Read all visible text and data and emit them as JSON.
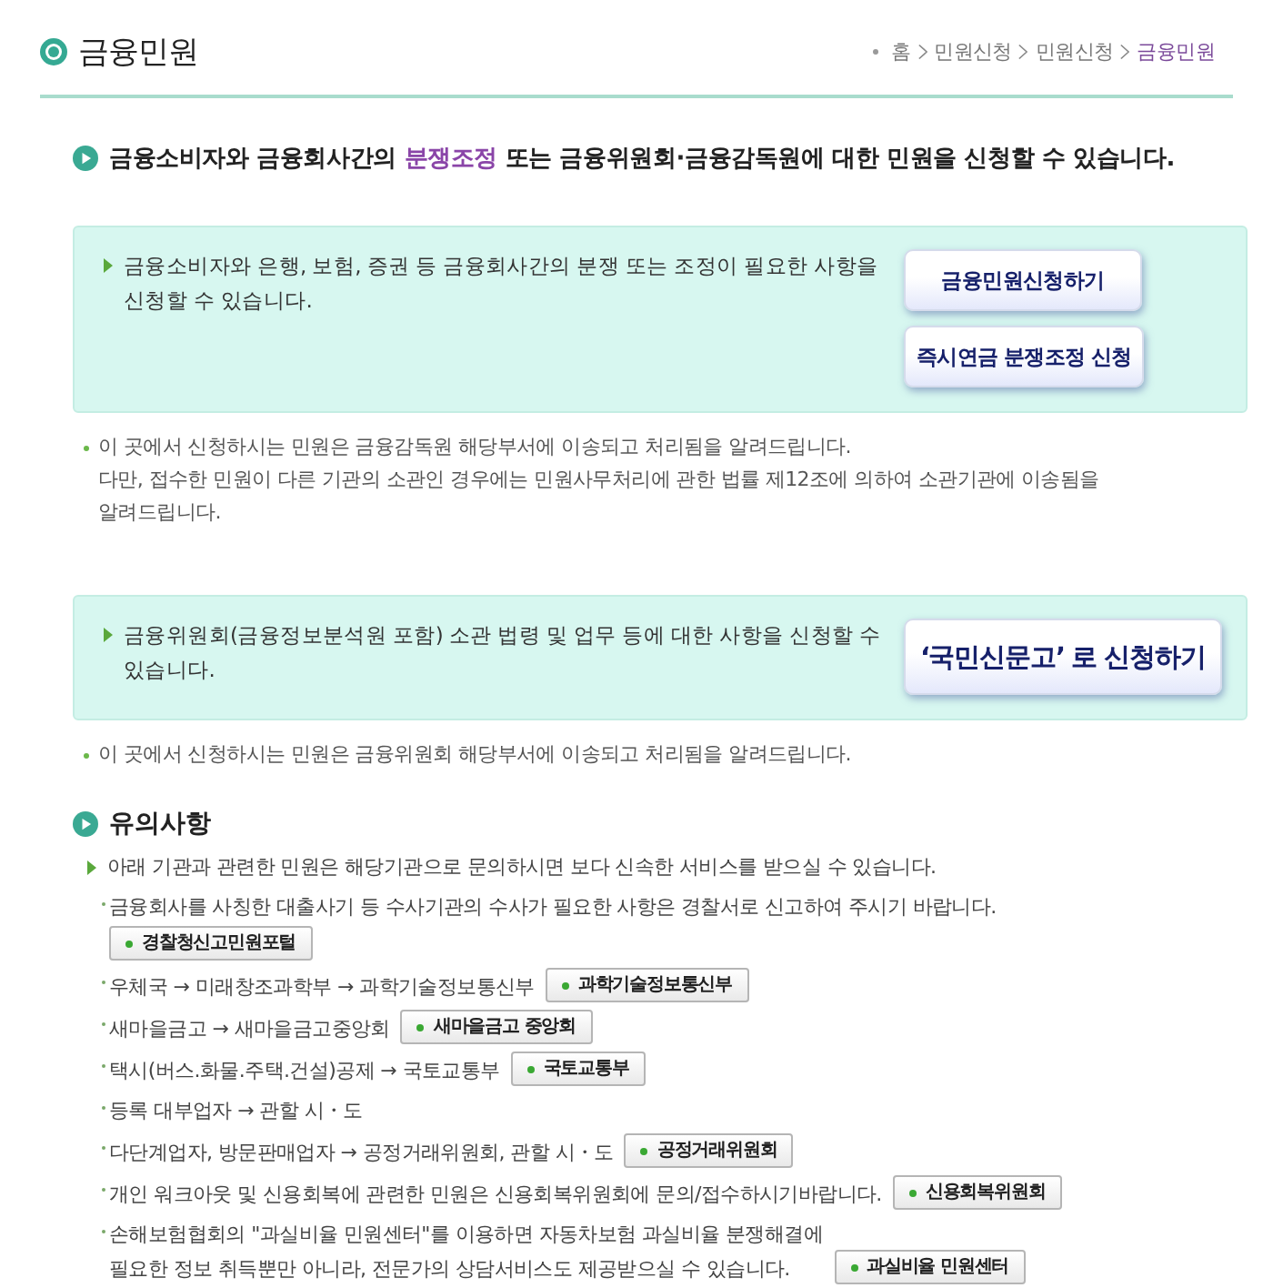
{
  "header": {
    "title": "금융민원",
    "breadcrumb": [
      {
        "label": "홈",
        "current": false
      },
      {
        "label": "민원신청",
        "current": false
      },
      {
        "label": "민원신청",
        "current": false
      },
      {
        "label": "금융민원",
        "current": true
      }
    ]
  },
  "intro": {
    "segments": [
      {
        "text": "금융소비자와 금융회사간의 ",
        "highlight": false
      },
      {
        "text": "분쟁조정",
        "highlight": true
      },
      {
        "text": " 또는 금융위원회·금융감독원에 대한 민원을 신청할 수 있습니다.",
        "highlight": false
      }
    ]
  },
  "panels": [
    {
      "text": "금융소비자와 은행, 보험, 증권 등 금융회사간의 분쟁 또는 조정이 필요한 사항을 신청할 수 있습니다.",
      "buttons": [
        "금융민원신청하기",
        "즉시연금 분쟁조정 신청"
      ],
      "note": {
        "lines": [
          "이 곳에서 신청하시는 민원은 금융감독원 해당부서에 이송되고 처리됨을 알려드립니다.",
          "다만, 접수한 민원이 다른 기관의 소관인 경우에는 민원사무처리에 관한 법률 제12조에 의하여 소관기관에 이송됨을 알려드립니다."
        ]
      }
    },
    {
      "text": "금융위원회(금융정보분석원 포함) 소관 법령 및 업무 등에 대한 사항을 신청할 수 있습니다.",
      "buttons": [
        "‘국민신문고’ 로 신청하기"
      ],
      "note": {
        "lines": [
          "이 곳에서 신청하시는 민원은 금융위원회 해당부서에 이송되고 처리됨을 알려드립니다."
        ]
      }
    }
  ],
  "notice": {
    "title": "유의사항",
    "lead": "아래 기관과 관련한 민원은 해당기관으로 문의하시면 보다 신속한 서비스를 받으실 수 있습니다.",
    "items": [
      {
        "lines": [
          "금융회사를 사칭한 대출사기 등 수사기관의 수사가 필요한 사항은 경찰서로 신고하여 주시기 바랍니다."
        ],
        "link": "경찰청신고민원포털"
      },
      {
        "lines": [
          "우체국 → 미래창조과학부 → 과학기술정보통신부"
        ],
        "link": "과학기술정보통신부"
      },
      {
        "lines": [
          "새마을금고 → 새마을금고중앙회"
        ],
        "link": "새마을금고 중앙회"
      },
      {
        "lines": [
          "택시(버스.화물.주택.건설)공제 → 국토교통부"
        ],
        "link": "국토교통부"
      },
      {
        "lines": [
          "등록 대부업자 → 관할 시・도"
        ]
      },
      {
        "lines": [
          "다단계업자, 방문판매업자 → 공정거래위원회, 관할 시・도"
        ],
        "link": "공정거래위원회"
      },
      {
        "lines": [
          "개인 워크아웃 및 신용회복에 관련한 민원은 신용회복위원회에 문의/접수하시기바랍니다."
        ],
        "link": "신용회복위원회"
      },
      {
        "lines": [
          "손해보험협회의 \"과실비율 민원센터\"를 이용하면 자동차보험 과실비율 분쟁해결에",
          "필요한 정보 취득뿐만 아니라, 전문가의 상담서비스도 제공받으실 수 있습니다."
        ],
        "link": "과실비율 민원센터"
      }
    ]
  }
}
